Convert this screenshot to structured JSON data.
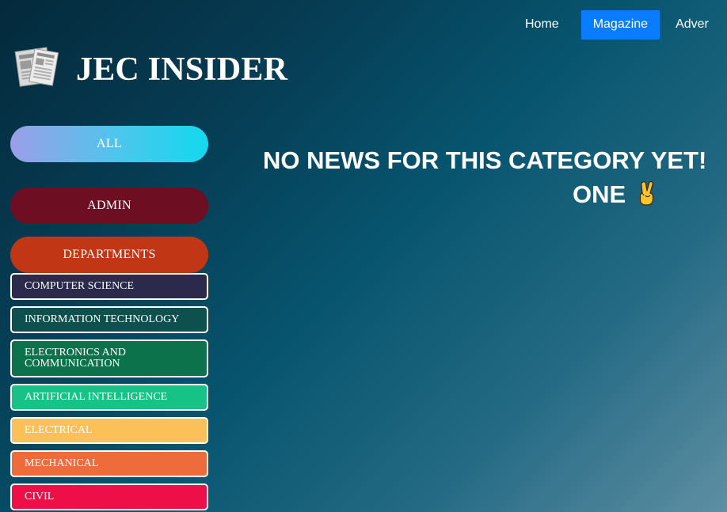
{
  "nav": {
    "items": [
      "Home",
      "Magazine",
      "Adver"
    ],
    "active": "Magazine"
  },
  "site": {
    "title": "JEC INSIDER",
    "logo_icon": "newspaper-icon"
  },
  "sidebar": {
    "all": "ALL",
    "admin": "ADMIN",
    "departments": "DEPARTMENTS",
    "department_items": [
      {
        "label": "COMPUTER SCIENCE",
        "color": "#2b2a4c"
      },
      {
        "label": "INFORMATION TECHNOLOGY",
        "color": "#0e504e"
      },
      {
        "label": "ELECTRONICS AND COMMUNICATION",
        "color": "#0c724c"
      },
      {
        "label": "ARTIFICIAL INTELLIGENCE",
        "color": "#17c286"
      },
      {
        "label": "ELECTRICAL",
        "color": "#fcc059"
      },
      {
        "label": "MECHANICAL",
        "color": "#ee6c3b"
      },
      {
        "label": "CIVIL",
        "color": "#ee0f48"
      }
    ]
  },
  "main": {
    "message_line1": "NO NEWS FOR THIS CATEGORY YET!",
    "message_line2": "ONE",
    "message_icon": "victory-hand-icon"
  },
  "colors": {
    "nav_active": "#0a7cff",
    "admin": "#6d0e22",
    "departments": "#c13614"
  }
}
